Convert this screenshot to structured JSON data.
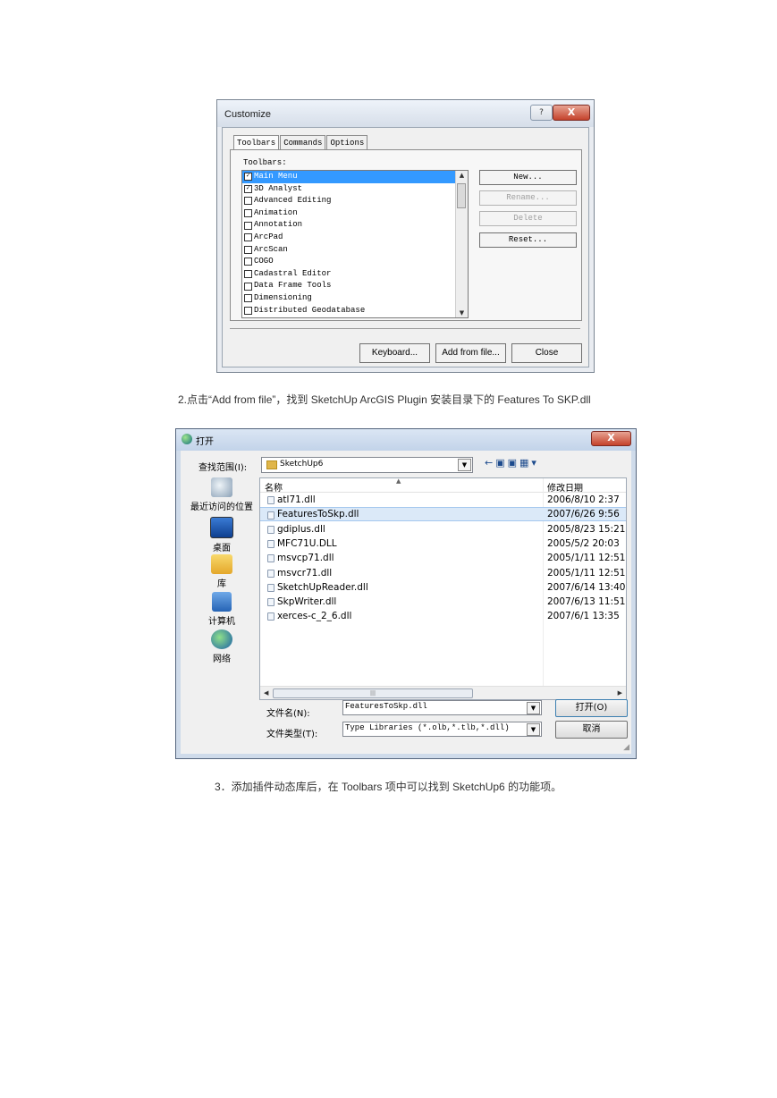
{
  "customize": {
    "title": "Customize",
    "help_glyph": "?",
    "close_glyph": "X",
    "tabs": [
      "Toolbars",
      "Commands",
      "Options"
    ],
    "toolbars_label": "Toolbars:",
    "list_items": [
      {
        "label": "Main Menu",
        "checked": true,
        "selected": true
      },
      {
        "label": "3D Analyst",
        "checked": true,
        "selected": false
      },
      {
        "label": "Advanced Editing",
        "checked": false,
        "selected": false
      },
      {
        "label": "Animation",
        "checked": false,
        "selected": false
      },
      {
        "label": "Annotation",
        "checked": false,
        "selected": false
      },
      {
        "label": "ArcPad",
        "checked": false,
        "selected": false
      },
      {
        "label": "ArcScan",
        "checked": false,
        "selected": false
      },
      {
        "label": "COGO",
        "checked": false,
        "selected": false
      },
      {
        "label": "Cadastral Editor",
        "checked": false,
        "selected": false
      },
      {
        "label": "Data Frame Tools",
        "checked": false,
        "selected": false
      },
      {
        "label": "Dimensioning",
        "checked": false,
        "selected": false
      },
      {
        "label": "Distributed Geodatabase",
        "checked": false,
        "selected": false
      }
    ],
    "buttons": {
      "new": "New...",
      "rename": "Rename...",
      "delete": "Delete",
      "reset": "Reset..."
    },
    "bottom_buttons": {
      "keyboard": "Keyboard...",
      "add_from_file": "Add from file...",
      "close": "Close"
    }
  },
  "caption_step2": "2.点击“Add from file”，找到 SketchUp ArcGIS Plugin 安装目录下的 Features To SKP.dll",
  "open_dialog": {
    "title": "打开",
    "close_glyph": "X",
    "look_in_label": "查找范围(I):",
    "look_in_value": "SketchUp6",
    "nav_icons": "←▣▣▦▾",
    "places": [
      "最近访问的位置",
      "桌面",
      "库",
      "计算机",
      "网络"
    ],
    "columns": {
      "name": "名称",
      "date": "修改日期"
    },
    "files": [
      {
        "name": "atl71.dll",
        "date": "2006/8/10 2:37"
      },
      {
        "name": "FeaturesToSkp.dll",
        "date": "2007/6/26 9:56",
        "selected": true
      },
      {
        "name": "gdiplus.dll",
        "date": "2005/8/23 15:21"
      },
      {
        "name": "MFC71U.DLL",
        "date": "2005/5/2 20:03"
      },
      {
        "name": "msvcp71.dll",
        "date": "2005/1/11 12:51"
      },
      {
        "name": "msvcr71.dll",
        "date": "2005/1/11 12:51"
      },
      {
        "name": "SketchUpReader.dll",
        "date": "2007/6/14 13:40"
      },
      {
        "name": "SkpWriter.dll",
        "date": "2007/6/13 11:51"
      },
      {
        "name": "xerces-c_2_6.dll",
        "date": "2007/6/1 13:35"
      }
    ],
    "filename_label": "文件名(N):",
    "filename_value": "FeaturesToSkp.dll",
    "filetype_label": "文件类型(T):",
    "filetype_value": "Type Libraries (*.olb,*.tlb,*.dll)",
    "open_button": "打开(O)",
    "cancel_button": "取消"
  },
  "caption_step3": "3．添加插件动态库后，在 Toolbars 项中可以找到 SketchUp6 的功能项。",
  "colors": {
    "selection": "#3399ff",
    "file_selection": "#dbe9f8",
    "close_red": "#c5422b"
  }
}
